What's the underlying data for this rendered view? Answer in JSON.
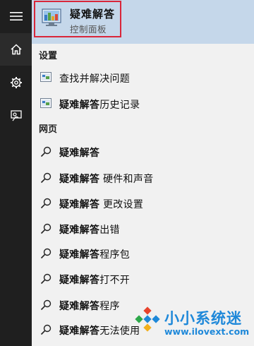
{
  "sidebar": {
    "items": [
      {
        "icon": "hamburger-menu-icon"
      },
      {
        "icon": "home-icon"
      },
      {
        "icon": "gear-icon"
      },
      {
        "icon": "feedback-icon"
      }
    ]
  },
  "best_match": {
    "title": "疑难解答",
    "subtitle": "控制面板",
    "icon": "control-panel-icon"
  },
  "settings_section": {
    "header": "设置",
    "items": [
      {
        "label_bold": "",
        "label_rest": "查找并解决问题",
        "icon": "settings-app-icon"
      },
      {
        "label_bold": "疑难解答",
        "label_rest": "历史记录",
        "icon": "settings-app-icon"
      }
    ]
  },
  "web_section": {
    "header": "网页",
    "items": [
      {
        "label_bold": "疑难解答",
        "label_rest": ""
      },
      {
        "label_bold": "疑难解答",
        "label_rest": " 硬件和声音"
      },
      {
        "label_bold": "疑难解答",
        "label_rest": " 更改设置"
      },
      {
        "label_bold": "疑难解答",
        "label_rest": "出错"
      },
      {
        "label_bold": "疑难解答",
        "label_rest": "程序包"
      },
      {
        "label_bold": "疑难解答",
        "label_rest": "打不开"
      },
      {
        "label_bold": "疑难解答",
        "label_rest": "程序"
      },
      {
        "label_bold": "疑难解答",
        "label_rest": "无法使用"
      }
    ]
  },
  "watermark": {
    "brand": "小小系统迷",
    "url": "www.ilovext.com"
  },
  "colors": {
    "rail": "#1f1f1f",
    "panel": "#f1f1f1",
    "selected_row": "#c5d7ea",
    "highlight_border": "#d9263a",
    "watermark": "#1e88d9"
  }
}
